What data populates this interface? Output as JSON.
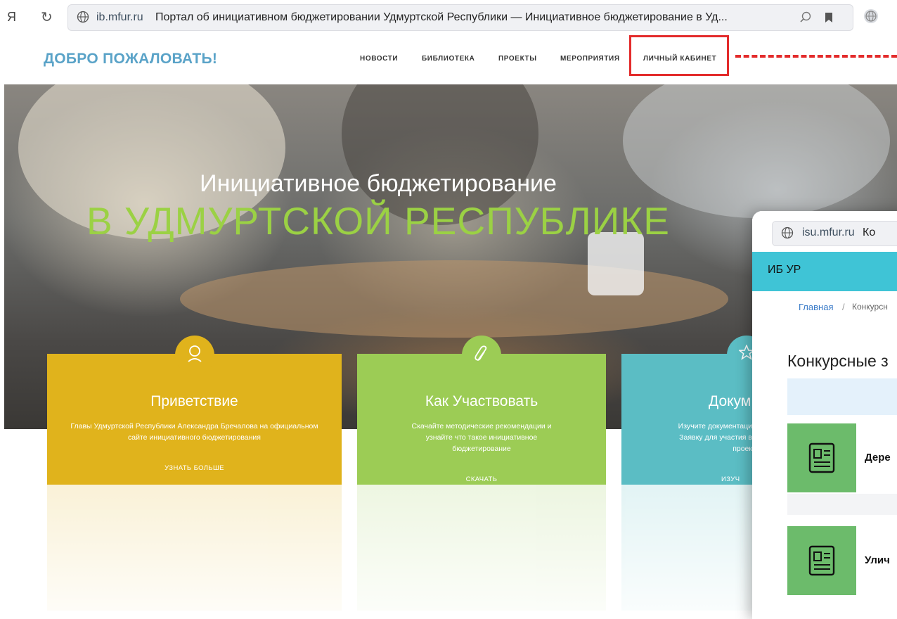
{
  "browser": {
    "left_glyph": "Я",
    "reload_icon": "reload-icon",
    "domain": "ib.mfur.ru",
    "tab_title": "Портал об инициативном бюджетировании Удмуртской Республики — Инициативное бюджетирование в Уд..."
  },
  "site": {
    "logo": "ДОБРО ПОЖАЛОВАТЬ!",
    "nav": [
      "НОВОСТИ",
      "БИБЛИОТЕКА",
      "ПРОЕКТЫ",
      "МЕРОПРИЯТИЯ",
      "ЛИЧНЫЙ КАБИНЕТ"
    ],
    "highlight_color": "#e32b2b"
  },
  "hero": {
    "line1": "Инициативное бюджетирование",
    "line2": "В УДМУРТСКОЙ РЕСПУБЛИКЕ",
    "accent_color": "#9bd144"
  },
  "cards": [
    {
      "title": "Приветствие",
      "text": "Главы Удмуртской Республики Александра Бречалова на официальном сайте инициативного бюджетирования",
      "link": "УЗНАТЬ БОЛЬШЕ",
      "icon": "person-icon",
      "color": "#e0b31c"
    },
    {
      "title": "Как Участвовать",
      "text": "Скачайте методические рекомендации и узнайте что такое инициативное бюджетирование",
      "link": "СКАЧАТЬ",
      "icon": "paperclip-icon",
      "color": "#9ccc55"
    },
    {
      "title": "Докум",
      "text_lines": [
        "Изучите документаци",
        "Заявку для участия в",
        "проек"
      ],
      "link": "ИЗУЧ",
      "icon": "star-icon",
      "color": "#5bbdc4"
    }
  ],
  "overlay": {
    "domain": "isu.mfur.ru",
    "title_fragment": "Ко",
    "brand": "ИБ УР",
    "breadcrumb_home": "Главная",
    "breadcrumb_sep": "/",
    "breadcrumb_current": "Конкурсн",
    "heading": "Конкурсные з",
    "items": [
      {
        "label": "Дере",
        "icon": "document-icon"
      },
      {
        "label": "Улич",
        "icon": "document-icon"
      }
    ],
    "header_color": "#3fc4d6",
    "item_icon_color": "#6cbb6b"
  }
}
